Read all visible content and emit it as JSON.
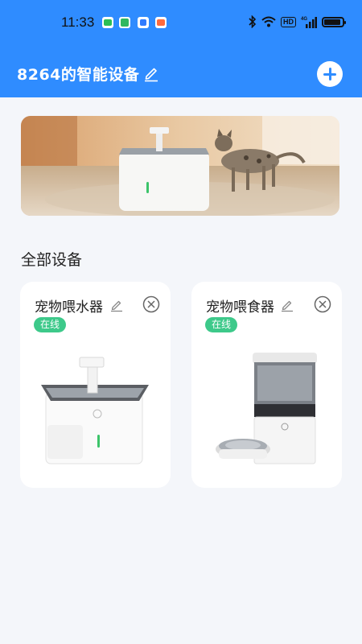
{
  "status_bar": {
    "time": "11:33",
    "network_badge": "HD",
    "network_type": "4G",
    "icons": [
      "wechat-icon",
      "chat-icon",
      "browser-icon",
      "app-icon",
      "bluetooth-icon",
      "wifi-icon",
      "signal-icon",
      "battery-icon"
    ]
  },
  "header": {
    "title": "8264的智能设备",
    "edit_icon": "pencil-icon",
    "add_icon": "plus-icon",
    "background": "#2f8cff"
  },
  "banner": {
    "image": "pet-water-fountain-with-cat-photo"
  },
  "section": {
    "title": "全部设备"
  },
  "devices": [
    {
      "name": "宠物喂水器",
      "status": "在线",
      "image": "pet-water-fountain-photo",
      "edit_icon": "pencil-icon",
      "remove_icon": "close-circle-icon"
    },
    {
      "name": "宠物喂食器",
      "status": "在线",
      "image": "pet-feeder-photo",
      "edit_icon": "pencil-icon",
      "remove_icon": "close-circle-icon"
    }
  ],
  "colors": {
    "primary": "#2f8cff",
    "online_badge": "#3dc98a",
    "page_background": "#f4f6fa"
  }
}
